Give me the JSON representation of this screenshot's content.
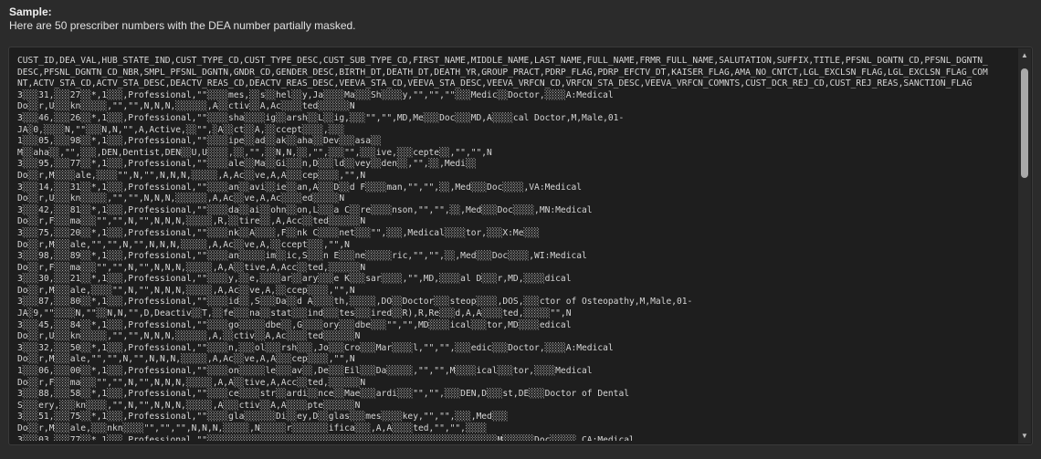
{
  "header": {
    "title": "Sample:",
    "subtitle": "Here are 50 prescriber numbers with the DEA number partially masked."
  },
  "lines": [
    "CUST_ID,DEA_VAL,HUB_STATE_IND,CUST_TYPE_CD,CUST_TYPE_DESC,CUST_SUB_TYPE_CD,FIRST_NAME,MIDDLE_NAME,LAST_NAME,FULL_NAME,FRMR_FULL_NAME,SALUTATION,SUFFIX,TITLE,PFSNL_DGNTN_CD,PFSNL_DGNTN_",
    "DESC,PFSNL_DGNTN_CD_NBR,SMPL_PFSNL_DGNTN,GNDR_CD,GENDER_DESC,BIRTH_DT,DEATH_DT,DEATH_YR,GROUP_PRACT,PDRP_FLAG,PDRP_EFCTV_DT,KAISER_FLAG,AMA_NO_CNTCT,LGL_EXCLSN_FLAG,LGL_EXCLSN_FLAG_COM",
    "NT,ACTV_STA_CD,ACTV_STA_DESC,DEACTV_REAS_CD,DEACTV_REAS_DESC,VEEVA_STA_CD,VEEVA_STA_DESC,VEEVA_VRFCN_CD,VRFCN_STA_DESC,VEEVA_VRFCN_COMNTS,CUST_DCR_REJ_CD,CUST_REJ_REAS,SANCTION_FLAG",
    "3░░░31,░░░27░░*,1░░░,Professional,\"\"░░░░mes,░░s░░hel░░y,Ja░░░░Ma░░░Sh░░░░y,\"\",\"\",\"\"░░░Medic░░Doctor,░░░░A:Medical",
    "Do░░r,U░░░kn░░░░░,\"\",\"\",N,N,N,░░░░░░,A░░ctiv░░A,Ac░░░░ted░░░░░░N",
    "3░░░46,░░░26░░*,1░░░,Professional,\"\"░░░░sha░░░░ig░░arsh░░L░░ig,░░░\"\",\"\",MD,Me░░░Doc░░░MD,A░░░░cal Doctor,M,Male,01-",
    "JA░0,░░░░N,\"\"░░░N,N,\"\",A,Active,░░\"\",░A░░ct░░A,░░ccept░░░░,░░░",
    "1░░░05,░░░98░░*,1░░░,Professional,\"\"░░░░ipe░░ad░░ak░░aha░░Dev░░░asa░░",
    "M░░aha░░,\"\",░░░,DEN,Dentist,DEN░░U,U░░░░,░░,\"\",░░N,N,░░,\"\",░░░\"\",░░░ive,░░░cepte░░,\"\",\"\",N",
    "3░░░95,░░░77░░*,1░░░,Professional,\"\"░░░░ale░░Ma░░Gi░░░n,D░░░ld░░vey░░den░░,\"\",░░,Medi░░",
    "Do░░r,M░░░░ale,░░░░\"\",N,\"\",N,N,N,░░░░░,A,Ac░░ve,A,A░░░cep░░░░,\"\",N",
    "3░░░14,░░░31░░*,1░░░,Professional,\"\"░░░░an░░avi░░ie░░an,A░░░D░░d F░░░░man,\"\",\"\",░░,Med░░░Doc░░░░,VA:Medical",
    "Do░░r,U░░░kn░░░░░,\"\",\"\",N,N,N,░░░░░░,A,Ac░░ve,A,Ac░░░░ed░░░░░N",
    "3░░░42,░░░81░░*,1░░░,Professional,\"\"░░░░da░░ai░░ohn░░on,L░░░a C░░re░░░░nson,\"\",\"\",░░,Med░░░Doc░░░░,MN:Medical",
    "Do░░r,F░░░ma░░░\"\",\"\",N,\"\",N,N,N,░░░░░,R,░░tire░░,A,Acc░░ted░░░░░░N",
    "3░░░75,░░░20░░*,1░░░,Professional,\"\"░░░░nk░░A░░░░,F░░nk C░░░░net░░░\"\",░░░,Medical░░░░tor,░░░X:Me░░░",
    "Do░░r,M░░░ale,\"\",\"\",N,\"\",N,N,N,░░░░░,A,Ac░░ve,A,░░ccept░░░,\"\",N",
    "3░░░98,░░░89░░*,1░░░,Professional,\"\"░░░░an░░░░░im░░ic,S░░░n E░░░ne░░░░░ric,\"\",\"\",░░,Med░░░Doc░░░░,WI:Medical",
    "Do░░r,F░░░ma░░░\"\",\"\",N,\"\",N,N,N,░░░░░,A,A░░tive,A,Acc░░ted,░░░░░░N",
    "3░░░30,░░░21░░*,1░░░,Professional,\"\"░░░░y,░░e,░░░░ar░░ary░░░e K░░░sar░░░░,\"\",MD,░░░░al D░░░r,MD,░░░░dical",
    "Do░░r,M░░░ale,░░░░\"\",N,\"\",N,N,N,░░░░░,A,Ac░░ve,A,░░ccep░░░░,\"\",N",
    "3░░░87,░░░80░░*,1░░░,Professional,\"\"░░░░id░░,S░░░Da░░d A░░░░th,░░░░░,DO░░Doctor░░░steop░░░░,DOS,░░░ctor of Osteopathy,M,Male,01-",
    "JA░9,\"\"░░░░N,\"\"░░N,N,\"\",D,Deactiv░░T,░░fe░░░na░░stat░░░ind░░░tes░░░ired░░R),R,Re░░░d,A,A░░░░ted,░░░░░\"\",N",
    "3░░░45,░░░84░░*,1░░░,Professional,\"\"░░░░go░░░░░dbe░░,G░░░░ory░░░dbe░░░\"\",\"\",MD░░░░ical░░░tor,MD░░░░edical",
    "Do░░r,U░░░kn░░░░░,\"\",\"\",N,N,N,░░░░░░,A,░░ctiv░░A,Ac░░░░ted░░░░░░N",
    "3░░░32,░░░50░░*,1░░░,Professional,\"\"░░░░n,░░░ol░░░rsh░░░,Jo░░░Cro░░░Mar░░░░l,\"\",\"\",░░░edic░░░Doctor,░░░░A:Medical",
    "Do░░r,M░░░ale,\"\",\"\",N,\"\",N,N,N,░░░░░,A,Ac░░ve,A,A░░░cep░░░░,\"\",N",
    "1░░░06,░░░00░░*,1░░░,Professional,\"\"░░░░on░░░░░le░░░av░░,De░░░Eil░░░Da░░░░░,\"\",\"\",M░░░░ical░░░tor,░░░░Medical",
    "Do░░r,F░░░ma░░░\"\",\"\",N,\"\",N,N,N,░░░░░,A,A░░tive,A,Acc░░ted,░░░░░░N",
    "3░░░88,░░░58░░*,1░░░,Professional,\"\"░░░░ce░░░░str░░ardi░░nce░░Mae░░░ardi░░░\"\",\"\",░░░DEN,D░░░st,DE░░░Doctor of Dental",
    "S░░░ery,░░░kn░░░░,\"\",N,\"\",N,N,N,░░░░░,A░░░ctiv░░A,A░░░░pte░░░░░░N",
    "3░░░51,░░░75░░*,1░░░,Professional,\"\"░░░░gla░░░░░░Di░░ey,D░░glas░░░mes░░░░key,\"\",\"\",░░░,Med░░░",
    "Do░░r,M░░░ale,░░░nkn░░░░\"\",\"\",\"\",N,N,N,░░░░░,N░░░░░r░░░░░░░ifica░░░,A,A░░░░ted,\"\",\"\",░░░░",
    "3░░░03,░░░77░░*,1░░░,Professional,\"\"░░░░░░░░░░░░░░░░░░░░░░░░░░░░░░░░░░░░░░░░░░░░░░░░░░░░░░░M░░░░░░Doc░░░░░,CA:Medical"
  ],
  "scrollbar": {
    "up_icon": "▲",
    "down_icon": "▼",
    "position": 0.0
  }
}
